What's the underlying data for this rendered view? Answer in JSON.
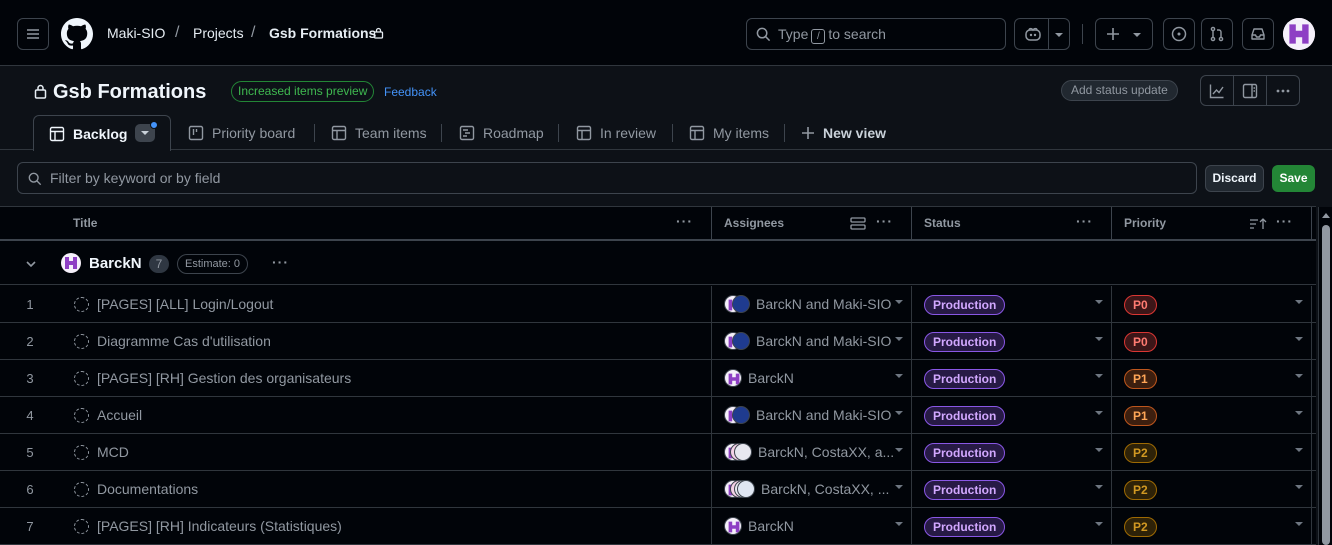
{
  "topbar": {
    "owner": "Maki-SIO",
    "projects": "Projects",
    "project": "Gsb Formations",
    "search_prefix": "Type",
    "search_key": "/",
    "search_suffix": "to search"
  },
  "header": {
    "title": "Gsb Formations",
    "preview_badge": "Increased items preview",
    "feedback": "Feedback",
    "status_update": "Add status update"
  },
  "tabs": [
    {
      "label": "Backlog"
    },
    {
      "label": "Priority board"
    },
    {
      "label": "Team items"
    },
    {
      "label": "Roadmap"
    },
    {
      "label": "In review"
    },
    {
      "label": "My items"
    },
    {
      "label": "New view"
    }
  ],
  "filter": {
    "placeholder": "Filter by keyword or by field",
    "discard": "Discard",
    "save": "Save"
  },
  "columns": {
    "title": "Title",
    "assignees": "Assignees",
    "status": "Status",
    "priority": "Priority"
  },
  "group": {
    "name": "BarckN",
    "count": "7",
    "estimate": "Estimate: 0"
  },
  "rows": [
    {
      "num": "1",
      "title": "[PAGES] [ALL] Login/Logout",
      "assignees": "BarckN and Maki-SIO",
      "status": "Production",
      "priority": "P0"
    },
    {
      "num": "2",
      "title": "Diagramme Cas d'utilisation",
      "assignees": "BarckN and Maki-SIO",
      "status": "Production",
      "priority": "P0"
    },
    {
      "num": "3",
      "title": "[PAGES] [RH] Gestion des organisateurs",
      "assignees": "BarckN",
      "status": "Production",
      "priority": "P1"
    },
    {
      "num": "4",
      "title": "Accueil",
      "assignees": "BarckN and Maki-SIO",
      "status": "Production",
      "priority": "P1"
    },
    {
      "num": "5",
      "title": "MCD",
      "assignees": "BarckN, CostaXX, a...",
      "status": "Production",
      "priority": "P2"
    },
    {
      "num": "6",
      "title": "Documentations",
      "assignees": "BarckN, CostaXX, ...",
      "status": "Production",
      "priority": "P2"
    },
    {
      "num": "7",
      "title": "[PAGES] [RH] Indicateurs (Statistiques)",
      "assignees": "BarckN",
      "status": "Production",
      "priority": "P2"
    }
  ],
  "colors": {
    "p0": "#f85149",
    "p1": "#db6d28",
    "p2": "#d29922",
    "production": "#8957e5",
    "save": "#238636"
  }
}
